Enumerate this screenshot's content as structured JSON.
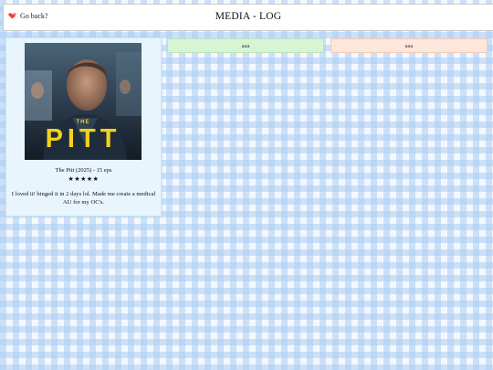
{
  "header": {
    "back_label": "Go back?",
    "title": "MEDIA - LOG"
  },
  "entry": {
    "poster_small_text": "THE",
    "poster_big_text": "PITT",
    "title_line": "The Pitt (2025) - 15 eps",
    "stars": "★★★★★",
    "rating": 5,
    "review": "I loved it! binged it in 2 days lol. Made me create a medical AU for my OC's."
  },
  "tabs": [
    {
      "label": "aaa",
      "color": "#d7f5d5"
    },
    {
      "label": "aaa",
      "color": "#fde6da"
    }
  ],
  "colors": {
    "gingham": "#aacdf5",
    "card_background": "#e8f5fd",
    "poster_text": "#f3d21a",
    "back_icon": "#e8443a"
  }
}
